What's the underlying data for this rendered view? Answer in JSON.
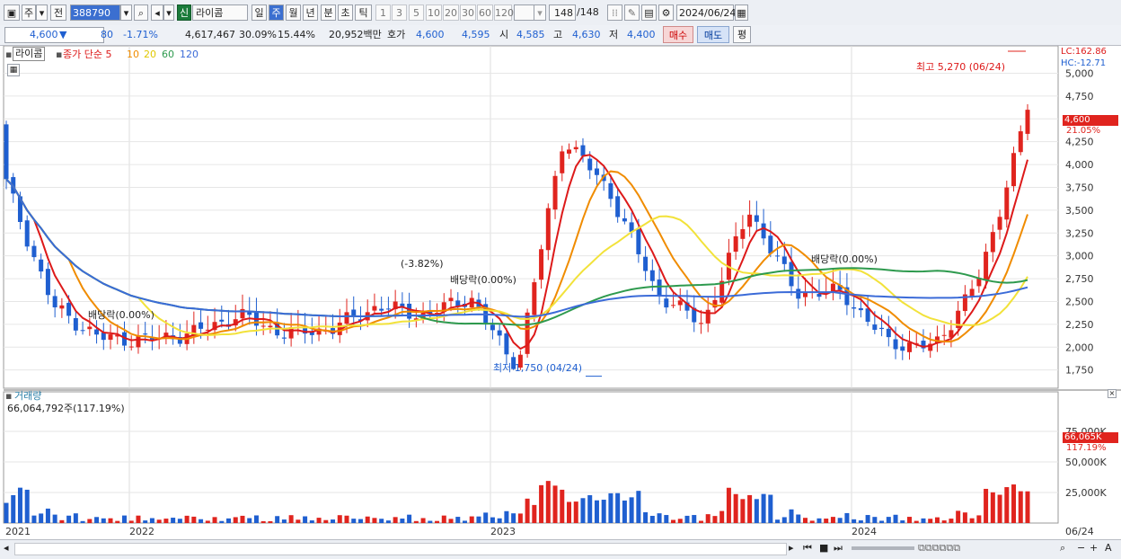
{
  "toolbar": {
    "mode_label": "주",
    "prev_label": "전",
    "code_value": "388790",
    "market_badge": "신",
    "stock_name": "라이콤",
    "periods": [
      "일",
      "주",
      "월",
      "년",
      "분",
      "초",
      "틱"
    ],
    "active_period": "주",
    "intervals": [
      "1",
      "3",
      "5",
      "10",
      "20",
      "30",
      "60",
      "120"
    ],
    "count_value": "148",
    "count_total": "/148",
    "date_value": "2024/06/24"
  },
  "quote": {
    "price": "4,600",
    "change_arrow": "▼",
    "change": "80",
    "change_pct": "-1.71%",
    "volume": "4,617,467",
    "vol_pct": "30.09%",
    "turnover": "15.44%",
    "amount": "20,952백만",
    "bid_label": "호가",
    "ask": "4,600",
    "bid": "4,595",
    "open_label": "시",
    "open": "4,585",
    "high_label": "고",
    "high": "4,630",
    "low_label": "저",
    "low": "4,400",
    "buy_label": "매수",
    "sell_label": "매도",
    "extra_label": "평"
  },
  "legend": {
    "name": "라이콤",
    "ma_label": "종가 단순 5",
    "ma10": "10",
    "ma20": "20",
    "ma60": "60",
    "ma120": "120"
  },
  "colors": {
    "up": "#e0241e",
    "down": "#1f5fd0",
    "ma5": "#dd1a1a",
    "ma10": "#f08c00",
    "ma20": "#f2e23a",
    "ma60": "#2e9a4e",
    "ma120": "#3b6bd8"
  },
  "price_panel": {
    "lc_label": "LC:162.86",
    "hc_label": "HC:-12.71",
    "current_tag": "4,600",
    "current_pct": "21.05%",
    "high_annotation": "최고 5,270 (06/24)",
    "low_annotation": "최저 1,750 (04/24)",
    "events": [
      {
        "text": "배당락(0.00%)"
      },
      {
        "text": "(-3.82%)"
      },
      {
        "text": "배당락(0.00%)"
      },
      {
        "text": "배당락(0.00%)"
      }
    ]
  },
  "volume_panel": {
    "title": "거래량",
    "summary": "66,064,792주(117.19%)",
    "current_tag": "66,065K",
    "current_pct": "117.19%"
  },
  "chart_data": {
    "type": "candlestick",
    "price_ticks": [
      1750,
      2000,
      2250,
      2500,
      2750,
      3000,
      3250,
      3500,
      3750,
      4000,
      4250,
      4500,
      4750,
      5000
    ],
    "price_tick_labels": [
      "1,750",
      "2,000",
      "2,250",
      "2,500",
      "2,750",
      "3,000",
      "3,250",
      "3,500",
      "3,750",
      "4,000",
      "4,250",
      "4,500",
      "4,750",
      "5,000"
    ],
    "volume_ticks": [
      25000,
      50000,
      75000
    ],
    "volume_tick_labels": [
      "25,000K",
      "50,000K",
      "75,000K"
    ],
    "x_labels": [
      "2021",
      "2022",
      "2023",
      "2024",
      "06/24"
    ],
    "price_range": [
      1550,
      5300
    ],
    "volume_range": [
      0,
      100000
    ],
    "weekly_close_key_points": [
      {
        "date": "2021-03",
        "value": 3800
      },
      {
        "date": "2021-04",
        "value": 2450
      },
      {
        "date": "2021-06",
        "value": 2100
      },
      {
        "date": "2021-12",
        "value": 2080
      },
      {
        "date": "2022-04",
        "value": 2150
      },
      {
        "date": "2022-06",
        "value": 2350
      },
      {
        "date": "2022-09",
        "value": 2150
      },
      {
        "date": "2022-10",
        "value": 2200
      },
      {
        "date": "2022-11",
        "value": 2450
      },
      {
        "date": "2023-01",
        "value": 2350
      },
      {
        "date": "2023-03",
        "value": 2550
      },
      {
        "date": "2023-04",
        "value": 1750
      },
      {
        "date": "2023-05",
        "value": 4300
      },
      {
        "date": "2023-06",
        "value": 3700
      },
      {
        "date": "2023-07",
        "value": 2600
      },
      {
        "date": "2023-08",
        "value": 2250
      },
      {
        "date": "2023-09",
        "value": 3500
      },
      {
        "date": "2023-10",
        "value": 2600
      },
      {
        "date": "2023-12",
        "value": 2600
      },
      {
        "date": "2024-02",
        "value": 2050
      },
      {
        "date": "2024-04",
        "value": 2000
      },
      {
        "date": "2024-05",
        "value": 2800
      },
      {
        "date": "2024-06",
        "value": 4600
      }
    ],
    "period_high": 5270,
    "period_low": 1750,
    "series": [
      {
        "name": "5"
      },
      {
        "name": "10"
      },
      {
        "name": "20"
      },
      {
        "name": "60"
      },
      {
        "name": "120"
      }
    ]
  }
}
